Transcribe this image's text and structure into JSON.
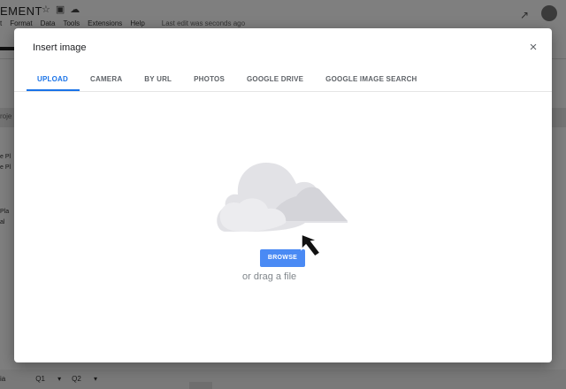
{
  "background": {
    "doc_title": "EMENT",
    "menu": [
      "t",
      "Format",
      "Data",
      "Tools",
      "Extensions",
      "Help"
    ],
    "status": "Last edit was seconds ago",
    "column_header": "roje",
    "side_items": [
      "e Pl",
      "e Pl",
      "Pla",
      "al"
    ],
    "bottom_tabs": [
      "ia",
      "Q1",
      "Q2"
    ]
  },
  "dialog": {
    "title": "Insert image",
    "close_label": "×",
    "tabs": [
      {
        "label": "UPLOAD",
        "active": true
      },
      {
        "label": "CAMERA",
        "active": false
      },
      {
        "label": "BY URL",
        "active": false
      },
      {
        "label": "PHOTOS",
        "active": false
      },
      {
        "label": "GOOGLE DRIVE",
        "active": false
      },
      {
        "label": "GOOGLE IMAGE SEARCH",
        "active": false
      }
    ],
    "browse_label": "BROWSE",
    "drag_text": "or drag a file"
  },
  "colors": {
    "accent": "#1a73e8",
    "browse_button": "#4a8af4",
    "cloud": "#e0e0e4"
  }
}
